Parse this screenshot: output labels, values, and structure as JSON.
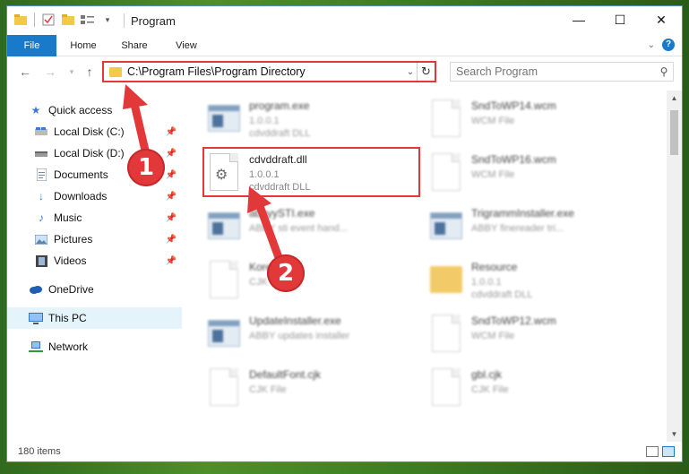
{
  "window": {
    "title": "Program",
    "buttons": {
      "minimize": "—",
      "maximize": "☐",
      "close": "✕"
    }
  },
  "ribbon": {
    "tabs": [
      "File",
      "Home",
      "Share",
      "View"
    ],
    "help": "?"
  },
  "navigation": {
    "address_path": "C:\\Program Files\\Program Directory",
    "search_placeholder": "Search Program"
  },
  "sidebar": {
    "items": [
      {
        "label": "Quick access",
        "icon": "star-icon",
        "pinned": false
      },
      {
        "label": "Local Disk (C:)",
        "icon": "drive-icon",
        "pinned": true
      },
      {
        "label": "Local Disk (D:)",
        "icon": "drive-icon",
        "pinned": true
      },
      {
        "label": "Documents",
        "icon": "document-icon",
        "pinned": true
      },
      {
        "label": "Downloads",
        "icon": "download-icon",
        "pinned": true
      },
      {
        "label": "Music",
        "icon": "music-icon",
        "pinned": true
      },
      {
        "label": "Pictures",
        "icon": "pictures-icon",
        "pinned": true
      },
      {
        "label": "Videos",
        "icon": "videos-icon",
        "pinned": true
      },
      {
        "label": "OneDrive",
        "icon": "cloud-icon",
        "pinned": false
      },
      {
        "label": "This PC",
        "icon": "computer-icon",
        "pinned": false,
        "selected": true
      },
      {
        "label": "Network",
        "icon": "network-icon",
        "pinned": false
      }
    ]
  },
  "files": [
    {
      "name": "program.exe",
      "line2": "1.0.0.1",
      "line3": "cdvddraft DLL",
      "icon": "app-icon",
      "blurred": true
    },
    {
      "name": "SndToWP14.wcm",
      "line2": "WCM File",
      "line3": "",
      "icon": "document-icon",
      "blurred": true
    },
    {
      "name": "cdvddraft.dll",
      "line2": "1.0.0.1",
      "line3": "cdvddraft DLL",
      "icon": "gear-document-icon",
      "blurred": false
    },
    {
      "name": "SndToWP16.wcm",
      "line2": "WCM File",
      "line3": "",
      "icon": "document-icon",
      "blurred": true
    },
    {
      "name": "abbyySTI.exe",
      "line2": "ABBY sti event hand...",
      "line3": "",
      "icon": "app-icon",
      "blurred": true
    },
    {
      "name": "TrigrammInstaller.exe",
      "line2": "ABBY finereader tri...",
      "line3": "",
      "icon": "app-icon",
      "blurred": true
    },
    {
      "name": "Korean.cjk",
      "line2": "CJK File",
      "line3": "",
      "icon": "document-icon",
      "blurred": true
    },
    {
      "name": "Resource",
      "line2": "1.0.0.1",
      "line3": "cdvddraft DLL",
      "icon": "folder-icon",
      "blurred": true
    },
    {
      "name": "UpdateInstaller.exe",
      "line2": "ABBY updates installer",
      "line3": "",
      "icon": "app-icon",
      "blurred": true
    },
    {
      "name": "SndToWP12.wcm",
      "line2": "WCM File",
      "line3": "",
      "icon": "document-icon",
      "blurred": true
    },
    {
      "name": "DefaultFont.cjk",
      "line2": "CJK File",
      "line3": "",
      "icon": "document-icon",
      "blurred": true
    },
    {
      "name": "gbl.cjk",
      "line2": "CJK File",
      "line3": "",
      "icon": "document-icon",
      "blurred": true
    }
  ],
  "status": {
    "item_count": "180 items"
  },
  "annotations": {
    "step1": "1",
    "step2": "2",
    "color": "#e2383a"
  }
}
